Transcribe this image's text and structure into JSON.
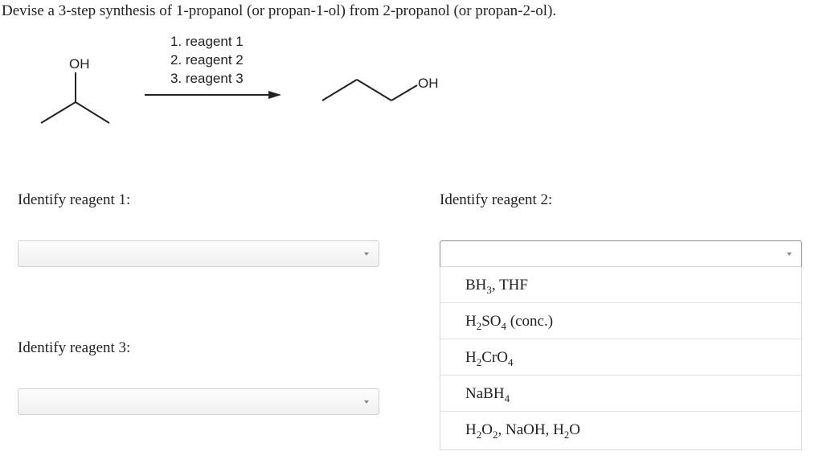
{
  "question": "Devise a 3-step synthesis of 1-propanol (or propan-1-ol) from 2-propanol (or propan-2-ol).",
  "scheme": {
    "reactant_label": "OH",
    "product_label": "OH",
    "steps": [
      "1. reagent 1",
      "2. reagent 2",
      "3. reagent 3"
    ]
  },
  "prompts": {
    "reagent1": "Identify reagent 1:",
    "reagent2": "Identify reagent 2:",
    "reagent3": "Identify reagent 3:"
  },
  "selects": {
    "reagent1": {
      "value": ""
    },
    "reagent2": {
      "value": "",
      "open": true
    },
    "reagent3": {
      "value": ""
    }
  },
  "options": [
    {
      "parts": [
        {
          "t": "BH"
        },
        {
          "sub": "3"
        },
        {
          "t": ", THF"
        }
      ]
    },
    {
      "parts": [
        {
          "t": "H"
        },
        {
          "sub": "2"
        },
        {
          "t": "SO"
        },
        {
          "sub": "4"
        },
        {
          "t": " (conc.)"
        }
      ]
    },
    {
      "parts": [
        {
          "t": "H"
        },
        {
          "sub": "2"
        },
        {
          "t": "CrO"
        },
        {
          "sub": "4"
        }
      ]
    },
    {
      "parts": [
        {
          "t": "NaBH"
        },
        {
          "sub": "4"
        }
      ]
    },
    {
      "parts": [
        {
          "t": "H"
        },
        {
          "sub": "2"
        },
        {
          "t": "O"
        },
        {
          "sub": "2"
        },
        {
          "t": ", NaOH, H"
        },
        {
          "sub": "2"
        },
        {
          "t": "O"
        }
      ]
    }
  ]
}
